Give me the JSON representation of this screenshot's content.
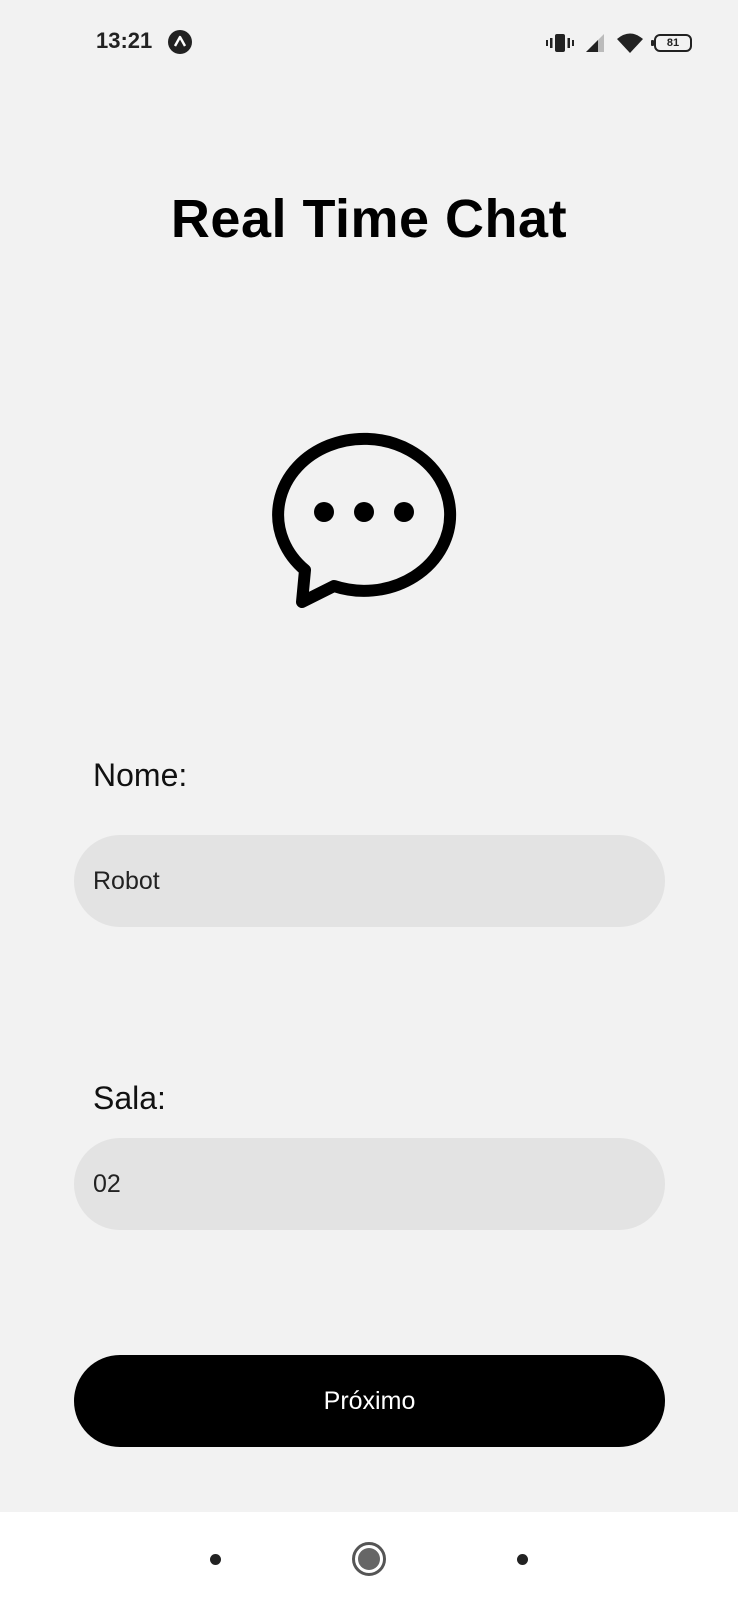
{
  "status_bar": {
    "time": "13:21",
    "battery_level": "81",
    "icons": [
      "app-notification-icon",
      "vibrate-icon",
      "signal-icon",
      "wifi-icon",
      "battery-icon"
    ]
  },
  "header": {
    "title": "Real Time Chat"
  },
  "logo": {
    "icon": "chat-bubble-icon"
  },
  "form": {
    "name_label": "Nome:",
    "name_value": "Robot",
    "room_label": "Sala:",
    "room_value": "02",
    "submit_label": "Próximo"
  },
  "colors": {
    "background": "#f2f2f2",
    "field_background": "#e3e3e3",
    "button_background": "#000000",
    "button_text": "#ffffff"
  },
  "nav_bar": {
    "icons": [
      "recent-apps-icon",
      "home-icon",
      "back-icon"
    ]
  }
}
